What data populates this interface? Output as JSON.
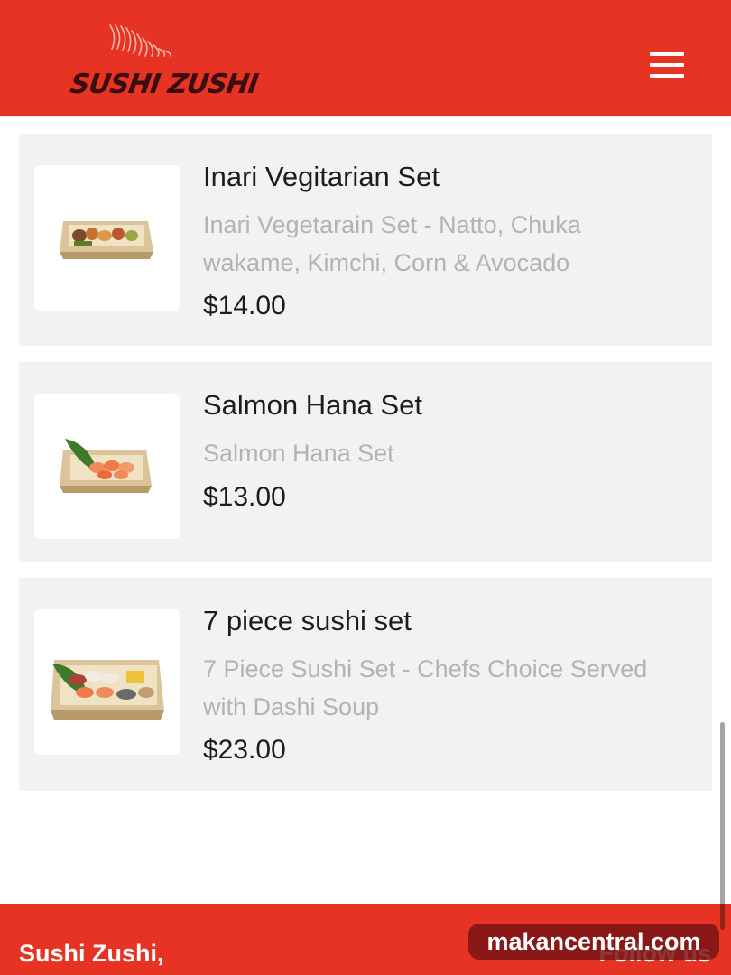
{
  "header": {
    "logo_text": "SUSHI ZUSHI",
    "menu_icon": "hamburger-menu-icon",
    "background_color": "#e63323"
  },
  "menu_items": [
    {
      "title": "Inari Vegitarian Set",
      "description": "Inari Vegetarain Set - Natto, Chuka wakame, Kimchi, Corn & Avocado",
      "price": "$14.00",
      "image_icon": "sushi-box-icon"
    },
    {
      "title": "Salmon Hana Set",
      "description": "Salmon Hana Set",
      "price": "$13.00",
      "image_icon": "sushi-box-icon"
    },
    {
      "title": "7 piece sushi set",
      "description": "7 Piece Sushi Set - Chefs Choice Served with Dashi Soup",
      "price": "$23.00",
      "image_icon": "sushi-box-icon"
    }
  ],
  "footer": {
    "name": "Sushi Zushi,",
    "follow_label": "Follow us"
  },
  "watermark": "makancentral.com"
}
